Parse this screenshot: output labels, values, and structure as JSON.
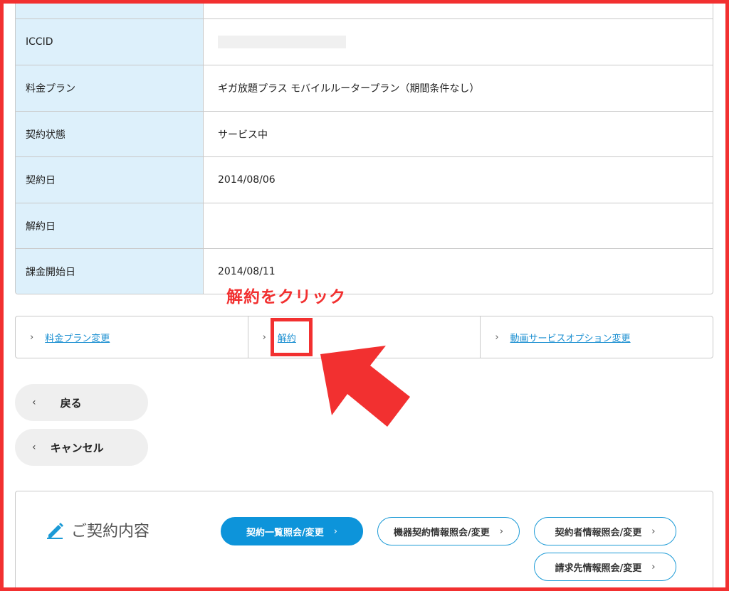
{
  "info_table": {
    "rows": [
      {
        "label": "",
        "value": ""
      },
      {
        "label": "ICCID",
        "value": ""
      },
      {
        "label": "料金プラン",
        "value": "ギガ放題プラス モバイルルータープラン（期間条件なし）"
      },
      {
        "label": "契約状態",
        "value": "サービス中"
      },
      {
        "label": "契約日",
        "value": "2014/08/06"
      },
      {
        "label": "解約日",
        "value": ""
      },
      {
        "label": "課金開始日",
        "value": "2014/08/11"
      }
    ]
  },
  "annotation": "解約をクリック",
  "actions": {
    "plan_change": "料金プラン変更",
    "cancel_contract": "解約",
    "video_option_change": "動画サービスオプション変更"
  },
  "nav": {
    "back_label": "戻る",
    "cancel_label": "キャンセル"
  },
  "contract_section": {
    "title": "ご契約内容",
    "buttons": {
      "contract_list": "契約一覧照会/変更",
      "device_contract": "機器契約情報照会/変更",
      "contractor_info": "契約者情報照会/変更",
      "billing_info": "請求先情報照会/変更"
    }
  },
  "icons": {
    "chevron_right": "›",
    "chevron_left": "‹",
    "pencil": "pencil-icon",
    "arrow": "red-pointer-arrow"
  },
  "colors": {
    "accent_blue": "#0d94da",
    "label_bg": "#ddf0fb",
    "annotation_red": "#f23030"
  }
}
